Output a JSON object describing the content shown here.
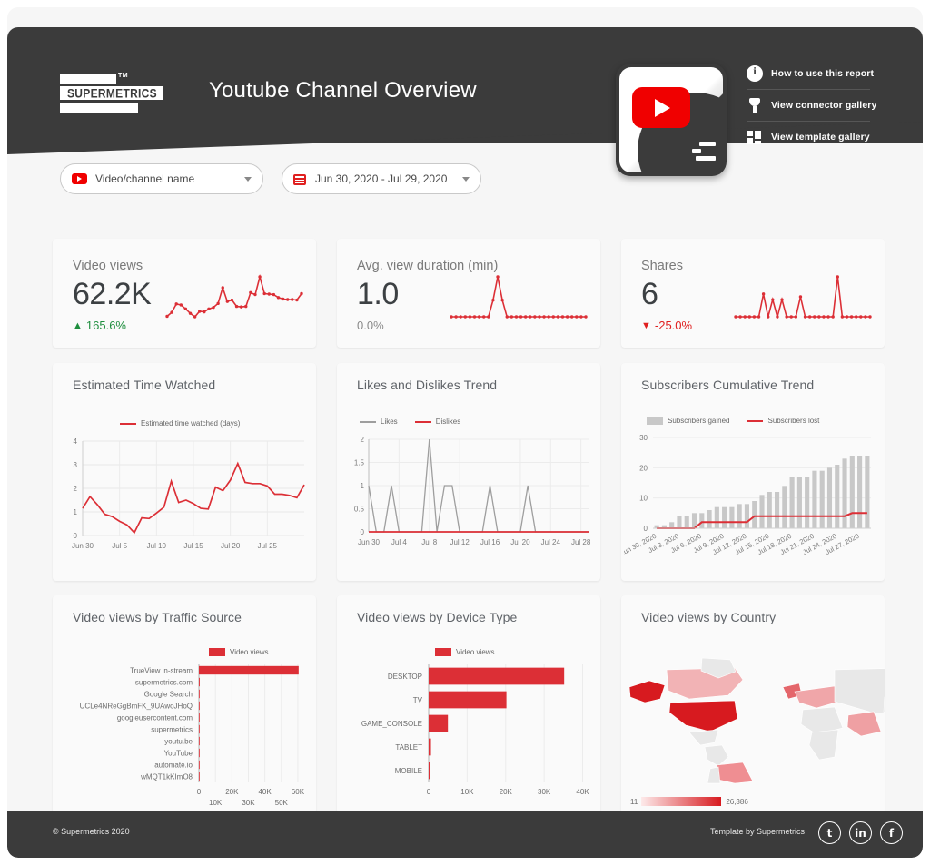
{
  "header": {
    "title": "Youtube Channel Overview",
    "logo_word": "SUPERMETRICS",
    "logo_tm": "TM",
    "links": [
      {
        "label": "How to use this report",
        "icon": "info-icon"
      },
      {
        "label": "View connector gallery",
        "icon": "plug-icon"
      },
      {
        "label": "View template gallery",
        "icon": "grid-icon"
      }
    ]
  },
  "filters": {
    "video_channel": {
      "label": "Video/channel name",
      "icon": "youtube-icon"
    },
    "date_range": {
      "label": "Jun 30, 2020 - Jul 29, 2020",
      "icon": "calendar-icon"
    }
  },
  "scorecards": [
    {
      "label": "Video views",
      "value": "62.2K",
      "delta": "165.6%",
      "direction": "up",
      "arrow": "▲"
    },
    {
      "label": "Avg. view duration (min)",
      "value": "1.0",
      "delta": "0.0%",
      "direction": "flat",
      "arrow": ""
    },
    {
      "label": "Shares",
      "value": "6",
      "delta": "-25.0%",
      "direction": "down",
      "arrow": "▼"
    }
  ],
  "cards": {
    "time_watched": "Estimated Time Watched",
    "likes_dislikes": "Likes and Dislikes Trend",
    "subscribers": "Subscribers Cumulative Trend",
    "traffic_source": "Video views by Traffic Source",
    "device_type": "Video views by Device Type",
    "country": "Video views by Country"
  },
  "colors": {
    "red": "#dc2f36",
    "gray": "#9e9e9e",
    "bar_gray": "#c8c8c8",
    "dark": "#3b3b3b",
    "green": "#1e8e3e"
  },
  "map_legend": {
    "min": "11",
    "max": "26,386"
  },
  "footer": {
    "copyright": "© Supermetrics 2020",
    "template_by": "Template by Supermetrics",
    "socials": [
      "twitter-icon",
      "linkedin-icon",
      "facebook-icon"
    ]
  },
  "chart_data": [
    {
      "type": "line",
      "name": "video-views-sparkline",
      "title": "Video views",
      "values": [
        1200,
        1600,
        2450,
        2350,
        1950,
        1500,
        1150,
        1700,
        1650,
        1950,
        2100,
        2500,
        4100,
        2700,
        2850,
        2200,
        2150,
        2200,
        3600,
        3400,
        5200,
        3500,
        3450,
        3400,
        3100,
        2950,
        2900,
        2900,
        2850,
        3500
      ],
      "grid": false
    },
    {
      "type": "line",
      "name": "avg-view-duration-sparkline",
      "title": "Avg. view duration (min)",
      "values": [
        1.0,
        1.0,
        1.0,
        1.0,
        1.0,
        1.0,
        1.0,
        1.0,
        1.0,
        1.05,
        1.12,
        1.05,
        1.0,
        1.0,
        1.0,
        1.0,
        1.0,
        1.0,
        1.0,
        1.0,
        1.0,
        1.0,
        1.0,
        1.0,
        1.0,
        1.0,
        1.0,
        1.0,
        1.0,
        1.0
      ],
      "grid": false
    },
    {
      "type": "line",
      "name": "shares-sparkline",
      "title": "Shares",
      "values": [
        0,
        0,
        0,
        0,
        0,
        0,
        8,
        0,
        6,
        0,
        6,
        0,
        0,
        0,
        7,
        0,
        0,
        0,
        0,
        0,
        0,
        0,
        14,
        0,
        0,
        0,
        0,
        0,
        0,
        0
      ],
      "grid": false
    },
    {
      "type": "line",
      "name": "estimated-time-watched",
      "title": "Estimated Time Watched",
      "legend": [
        "Estimated time watched (days)"
      ],
      "legend_position": "top-left",
      "xlabel": "",
      "ylabel": "",
      "ylim": [
        0,
        4
      ],
      "yticks": [
        0,
        1,
        2,
        3,
        4
      ],
      "xticks": [
        "Jun 30",
        "Jul 5",
        "Jul 10",
        "Jul 15",
        "Jul 20",
        "Jul 25"
      ],
      "grid": true,
      "x": [
        "Jun 30",
        "Jul 1",
        "Jul 2",
        "Jul 3",
        "Jul 4",
        "Jul 5",
        "Jul 6",
        "Jul 7",
        "Jul 8",
        "Jul 9",
        "Jul 10",
        "Jul 11",
        "Jul 12",
        "Jul 13",
        "Jul 14",
        "Jul 15",
        "Jul 16",
        "Jul 17",
        "Jul 18",
        "Jul 19",
        "Jul 20",
        "Jul 21",
        "Jul 22",
        "Jul 23",
        "Jul 24",
        "Jul 25",
        "Jul 26",
        "Jul 27",
        "Jul 28",
        "Jul 29"
      ],
      "values": [
        1.15,
        1.65,
        1.3,
        0.9,
        0.8,
        0.6,
        0.45,
        0.12,
        0.75,
        0.72,
        0.95,
        1.2,
        2.3,
        1.4,
        1.5,
        1.35,
        1.15,
        1.12,
        2.05,
        1.9,
        2.35,
        3.05,
        2.25,
        2.2,
        2.2,
        2.1,
        1.75,
        1.75,
        1.7,
        1.6,
        2.15
      ]
    },
    {
      "type": "line",
      "name": "likes-and-dislikes-trend",
      "title": "Likes and Dislikes Trend",
      "legend": [
        "Likes",
        "Dislikes"
      ],
      "legend_position": "top-left",
      "ylim": [
        0,
        2
      ],
      "yticks": [
        0,
        0.5,
        1,
        1.5,
        2
      ],
      "xticks": [
        "Jun 30",
        "Jul 4",
        "Jul 8",
        "Jul 12",
        "Jul 16",
        "Jul 20",
        "Jul 24",
        "Jul 28"
      ],
      "grid": true,
      "x": [
        "Jun 30",
        "Jul 1",
        "Jul 2",
        "Jul 3",
        "Jul 4",
        "Jul 5",
        "Jul 6",
        "Jul 7",
        "Jul 8",
        "Jul 9",
        "Jul 10",
        "Jul 11",
        "Jul 12",
        "Jul 13",
        "Jul 14",
        "Jul 15",
        "Jul 16",
        "Jul 17",
        "Jul 18",
        "Jul 19",
        "Jul 20",
        "Jul 21",
        "Jul 22",
        "Jul 23",
        "Jul 24",
        "Jul 25",
        "Jul 26",
        "Jul 27",
        "Jul 28",
        "Jul 29"
      ],
      "series": [
        {
          "name": "Likes",
          "color": "#9e9e9e",
          "values": [
            1,
            0,
            0,
            1,
            0,
            0,
            0,
            0,
            2,
            0,
            1,
            1,
            0,
            0,
            0,
            0,
            1,
            0,
            0,
            0,
            0,
            1,
            0,
            0,
            0,
            0,
            0,
            0,
            0,
            0
          ]
        },
        {
          "name": "Dislikes",
          "color": "#dc2f36",
          "values": [
            0,
            0,
            0,
            0,
            0,
            0,
            0,
            0,
            0,
            0,
            0,
            0,
            0,
            0,
            0,
            0,
            0,
            0,
            0,
            0,
            0,
            0,
            0,
            0,
            0,
            0,
            0,
            0,
            0,
            0
          ]
        }
      ]
    },
    {
      "type": "bar",
      "name": "subscribers-cumulative-trend",
      "title": "Subscribers Cumulative Trend",
      "legend": [
        "Subscribers gained",
        "Subscribers lost"
      ],
      "legend_position": "top-left",
      "ylim": [
        0,
        30
      ],
      "yticks": [
        0,
        10,
        20,
        30
      ],
      "grid": true,
      "categories": [
        "Jun 30, 2020",
        "Jul 1, 2020",
        "Jul 2, 2020",
        "Jul 3, 2020",
        "Jul 4, 2020",
        "Jul 5, 2020",
        "Jul 6, 2020",
        "Jul 7, 2020",
        "Jul 8, 2020",
        "Jul 9, 2020",
        "Jul 10, 2020",
        "Jul 11, 2020",
        "Jul 12, 2020",
        "Jul 13, 2020",
        "Jul 14, 2020",
        "Jul 15, 2020",
        "Jul 16, 2020",
        "Jul 17, 2020",
        "Jul 18, 2020",
        "Jul 19, 2020",
        "Jul 20, 2020",
        "Jul 21, 2020",
        "Jul 22, 2020",
        "Jul 23, 2020",
        "Jul 24, 2020",
        "Jul 25, 2020",
        "Jul 26, 2020",
        "Jul 27, 2020",
        "Jul 28, 2020"
      ],
      "xticks": [
        "Jun 30, 2020",
        "Jul 3, 2020",
        "Jul 6, 2020",
        "Jul 9, 2020",
        "Jul 12, 2020",
        "Jul 15, 2020",
        "Jul 18, 2020",
        "Jul 21, 2020",
        "Jul 24, 2020",
        "Jul 27, 2020"
      ],
      "series": [
        {
          "name": "Subscribers gained",
          "type": "bar",
          "color": "#c8c8c8",
          "values": [
            1,
            1,
            2,
            4,
            4,
            5,
            5,
            6,
            7,
            7,
            7,
            8,
            8,
            9,
            11,
            12,
            12,
            14,
            17,
            17,
            17,
            19,
            19,
            20,
            21,
            23,
            24,
            24,
            24
          ]
        },
        {
          "name": "Subscribers lost",
          "type": "line",
          "color": "#dc2f36",
          "values": [
            0,
            0,
            0,
            0,
            0,
            0,
            2,
            2,
            2,
            2,
            2,
            2,
            2,
            4,
            4,
            4,
            4,
            4,
            4,
            4,
            4,
            4,
            4,
            4,
            4,
            4,
            5,
            5,
            5
          ]
        }
      ]
    },
    {
      "type": "bar",
      "name": "video-views-by-traffic-source",
      "title": "Video views by Traffic Source",
      "orientation": "horizontal",
      "legend": [
        "Video views"
      ],
      "legend_position": "top",
      "xticks": [
        "0",
        "10K",
        "20K",
        "30K",
        "40K",
        "50K",
        "60K"
      ],
      "xlim": [
        0,
        65000
      ],
      "grid": true,
      "categories": [
        "TrueView in-stream",
        "supermetrics.com",
        "Google Search",
        "UCLe4NReGgBmFK_9UAwoJHoQ",
        "googleusercontent.com",
        "supermetrics",
        "youtu.be",
        "YouTube",
        "automate.io",
        "wMQT1kKImO8"
      ],
      "values": [
        60500,
        500,
        400,
        350,
        120,
        90,
        70,
        60,
        40,
        30
      ]
    },
    {
      "type": "bar",
      "name": "video-views-by-device-type",
      "title": "Video views by Device Type",
      "orientation": "horizontal",
      "legend": [
        "Video views"
      ],
      "legend_position": "top",
      "xticks": [
        "0",
        "10K",
        "20K",
        "30K",
        "40K"
      ],
      "xlim": [
        0,
        42000
      ],
      "grid": true,
      "categories": [
        "DESKTOP",
        "TV",
        "GAME_CONSOLE",
        "TABLET",
        "MOBILE"
      ],
      "values": [
        35200,
        20200,
        5000,
        600,
        300
      ]
    },
    {
      "type": "heatmap",
      "name": "video-views-by-country",
      "title": "Video views by Country",
      "legend_min": "11",
      "legend_max": "26,386",
      "highlighted_regions": [
        "United States",
        "Canada",
        "Brazil",
        "United Kingdom",
        "India",
        "Australia",
        "Europe"
      ]
    }
  ]
}
